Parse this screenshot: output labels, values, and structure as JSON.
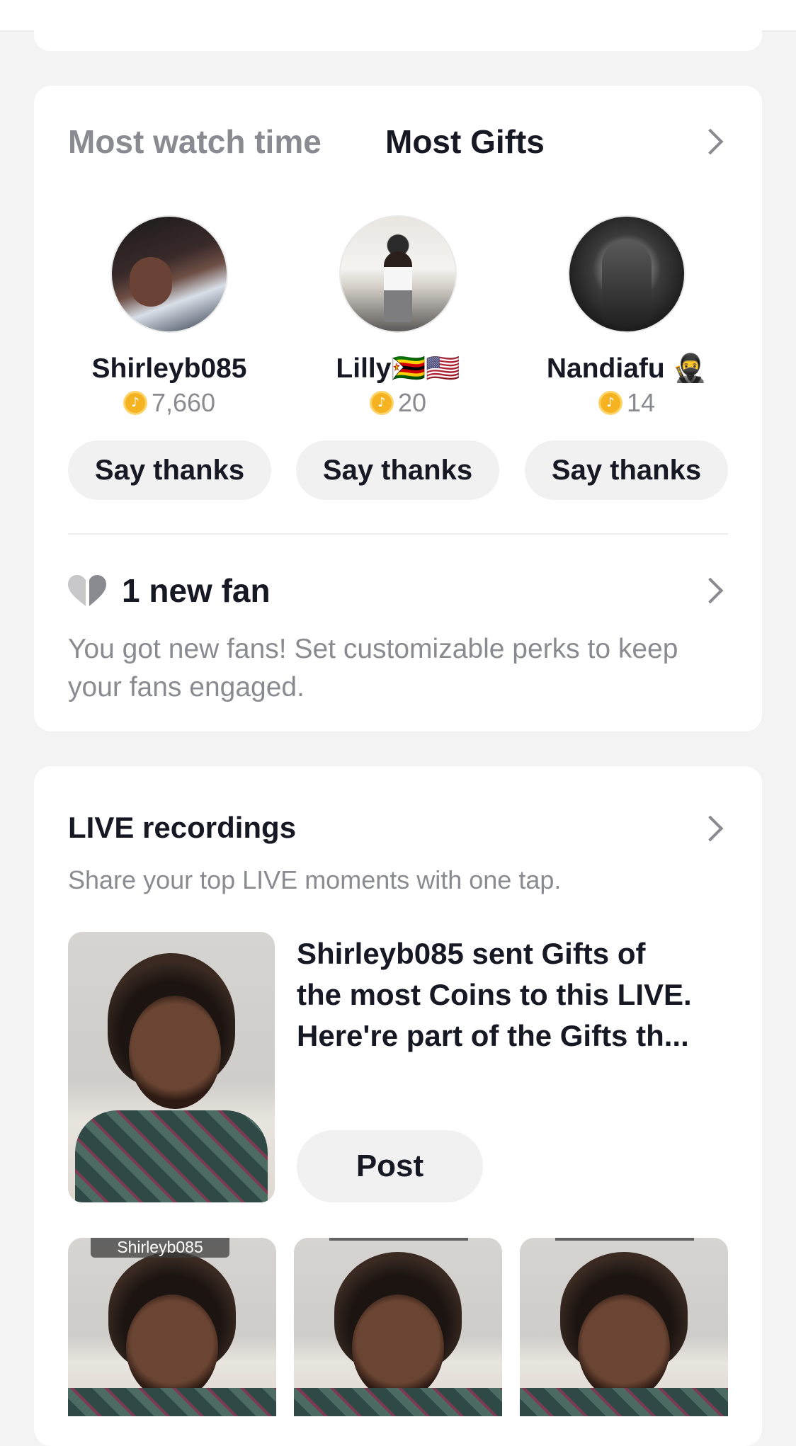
{
  "tabs": {
    "watch_time": "Most watch time",
    "gifts": "Most Gifts"
  },
  "gifters": [
    {
      "name": "Shirleyb085",
      "coins": "7,660"
    },
    {
      "name": "Lilly🇿🇼🇺🇸",
      "coins": "20"
    },
    {
      "name": "Nandiafu 🥷",
      "coins": "14"
    }
  ],
  "say_thanks_label": "Say thanks",
  "fans": {
    "title": "1 new fan",
    "description": "You got new fans! Set customizable perks to keep your fans engaged."
  },
  "live_recordings": {
    "title": "LIVE recordings",
    "subtitle": "Share your top LIVE moments with one tap.",
    "recording_text_lines": [
      "Shirleyb085 sent Gifts of",
      "the most Coins to this LIVE.",
      "Here're part of the Gifts th..."
    ],
    "post_label": "Post",
    "thumb_label": "Shirleyb085"
  },
  "icons": {
    "chevron": "chevron-right-icon",
    "heart": "half-heart-icon",
    "coin": "coin-icon"
  },
  "colors": {
    "background": "#f3f3f3",
    "card": "#ffffff",
    "secondary_text": "#8a8b91",
    "coin": "#f6b321"
  }
}
